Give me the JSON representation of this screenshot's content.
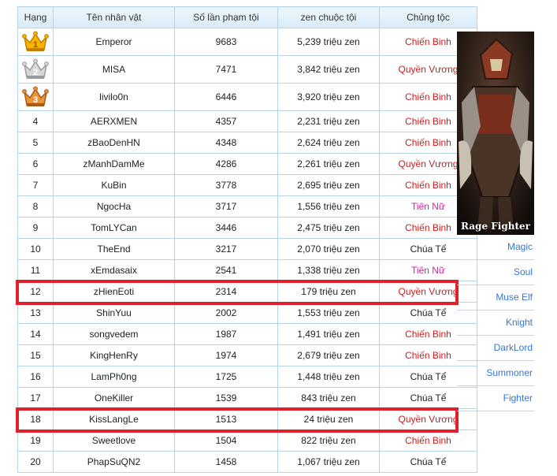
{
  "table": {
    "headers": {
      "rank": "Hạng",
      "name": "Tên nhân vật",
      "kills": "Số lần phạm tội",
      "zen": "zen chuộc tội",
      "class": "Chủng tộc"
    },
    "rows": [
      {
        "rank": "1",
        "crown": "gold",
        "name": "Emperor",
        "kills": "9683",
        "zen": "5,239 triệu zen",
        "class": "Chiến Binh"
      },
      {
        "rank": "2",
        "crown": "silver",
        "name": "MISA",
        "kills": "7471",
        "zen": "3,842 triệu zen",
        "class": "Quyền Vương"
      },
      {
        "rank": "3",
        "crown": "bronze",
        "name": "livilo0n",
        "kills": "6446",
        "zen": "3,920 triệu zen",
        "class": "Chiến Binh"
      },
      {
        "rank": "4",
        "name": "AERXMEN",
        "kills": "4357",
        "zen": "2,231 triệu zen",
        "class": "Chiến Binh"
      },
      {
        "rank": "5",
        "name": "zBaoDenHN",
        "kills": "4348",
        "zen": "2,624 triệu zen",
        "class": "Chiến Binh"
      },
      {
        "rank": "6",
        "name": "zManhDamMe",
        "kills": "4286",
        "zen": "2,261 triệu zen",
        "class": "Quyền Vương"
      },
      {
        "rank": "7",
        "name": "KuBin",
        "kills": "3778",
        "zen": "2,695 triệu zen",
        "class": "Chiến Binh"
      },
      {
        "rank": "8",
        "name": "NgocHa",
        "kills": "3717",
        "zen": "1,556 triệu zen",
        "class": "Tiên Nữ"
      },
      {
        "rank": "9",
        "name": "TomLYCan",
        "kills": "3446",
        "zen": "2,475 triệu zen",
        "class": "Chiến Binh"
      },
      {
        "rank": "10",
        "name": "TheEnd",
        "kills": "3217",
        "zen": "2,070 triệu zen",
        "class": "Chúa Tể"
      },
      {
        "rank": "11",
        "name": "xEmdasaix",
        "kills": "2541",
        "zen": "1,338 triệu zen",
        "class": "Tiên Nữ"
      },
      {
        "rank": "12",
        "name": "zHienEoti",
        "kills": "2314",
        "zen": "179 triệu zen",
        "class": "Quyền Vương"
      },
      {
        "rank": "13",
        "name": "ShinYuu",
        "kills": "2002",
        "zen": "1,553 triệu zen",
        "class": "Chúa Tể"
      },
      {
        "rank": "14",
        "name": "songvedem",
        "kills": "1987",
        "zen": "1,491 triệu zen",
        "class": "Chiến Binh"
      },
      {
        "rank": "15",
        "name": "KingHenRy",
        "kills": "1974",
        "zen": "2,679 triệu zen",
        "class": "Chiến Binh"
      },
      {
        "rank": "16",
        "name": "LamPh0ng",
        "kills": "1725",
        "zen": "1,448 triệu zen",
        "class": "Chúa Tể"
      },
      {
        "rank": "17",
        "name": "OneKiller",
        "kills": "1539",
        "zen": "843 triệu zen",
        "class": "Chúa Tể"
      },
      {
        "rank": "18",
        "name": "KissLangLe",
        "kills": "1513",
        "zen": "24 triệu zen",
        "class": "Quyền Vương"
      },
      {
        "rank": "19",
        "name": "Sweetlove",
        "kills": "1504",
        "zen": "822 triệu zen",
        "class": "Chiến Binh"
      },
      {
        "rank": "20",
        "name": "PhapSuQN2",
        "kills": "1458",
        "zen": "1,067 triệu zen",
        "class": "Chúa Tể"
      }
    ]
  },
  "class_colors": {
    "Chiến Binh": "#cc1e1e",
    "Quyền Vương": "#cc1e1e",
    "Tiên Nữ": "#e01aa6",
    "Chúa Tể": "#222222"
  },
  "highlight_color": "#e0212b",
  "sidebar": {
    "portrait_label": "Rage Fighter",
    "class_links": [
      "Magic",
      "Soul",
      "Muse Elf",
      "Knight",
      "DarkLord",
      "Summoner",
      "Fighter"
    ]
  }
}
